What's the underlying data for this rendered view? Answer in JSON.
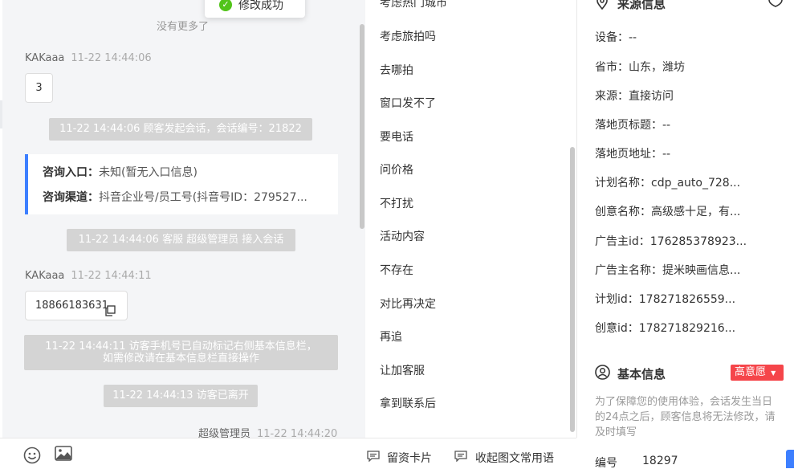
{
  "toast": {
    "text": "修改成功"
  },
  "chat": {
    "no_more": "没有更多了",
    "messages": [
      {
        "name": "KAKaaa",
        "time": "11-22 14:44:06",
        "text": "3"
      },
      {
        "name": "KAKaaa",
        "time": "11-22 14:44:11",
        "text": "18866183631"
      },
      {
        "name": "超级管理员",
        "time": "11-22 14:44:20"
      }
    ],
    "system": [
      "11-22 14:44:06 顾客发起会话，会话编号：21822",
      "11-22 14:44:06 客服 超级管理员 接入会话",
      "11-22 14:44:11 访客手机号已自动标记右侧基本信息栏，",
      "如需修改请在基本信息栏直接操作",
      "11-22 14:44:13 访客已离开"
    ],
    "info_card": {
      "entry_label": "咨询入口：",
      "entry_value": "未知(暂无入口信息)",
      "channel_label": "咨询渠道：",
      "channel_value": "抖音企业号/员工号(抖音号ID：279527..."
    }
  },
  "phrases": {
    "items": [
      "考虑热门城市",
      "考虑旅拍吗",
      "去哪拍",
      "窗口发不了",
      "要电话",
      "问价格",
      "不打扰",
      "活动内容",
      "不存在",
      "对比再决定",
      "再追",
      "让加客服",
      "拿到联系后"
    ]
  },
  "bottom_bar": {
    "card_label": "留资卡片",
    "collapse_label": "收起图文常用语"
  },
  "source": {
    "title": "来源信息",
    "fields": [
      "设备：--",
      "省市：山东，潍坊",
      "来源：直接访问",
      "落地页标题：--",
      "落地页地址：--",
      "计划名称：cdp_auto_728...",
      "创意名称：高级感十足，有...",
      "广告主id：176285378923...",
      "广告主名称：提米映画信息...",
      "计划id：178271826559...",
      "创意id：178271829216..."
    ]
  },
  "basic": {
    "title": "基本信息",
    "tag": "高意愿",
    "note": "为了保障您的使用体验，会话发生当日的24点之后，顾客信息将无法修改，请及时填写",
    "number_label": "编号",
    "number_value": "18297"
  },
  "colors": {
    "accent": "#3d7fff",
    "tag_red": "#f5454a",
    "success": "#52c41a"
  }
}
